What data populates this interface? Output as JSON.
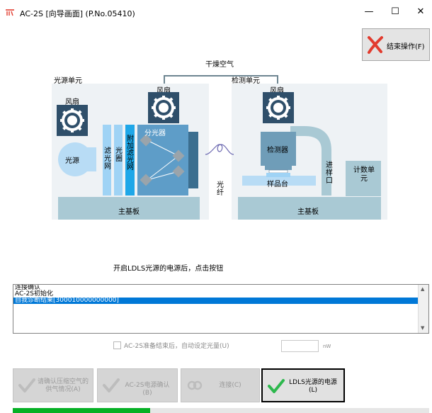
{
  "window": {
    "title": "AC-2S  [向导画面]  (P.No.05410)",
    "minimize": "—",
    "maximize": "☐",
    "close": "✕"
  },
  "exit_button": {
    "label": "结束操作(F)"
  },
  "diagram": {
    "dry_air": "干燥空气",
    "light_unit": "光源单元",
    "detect_unit": "检测单元",
    "fan": "风扇",
    "light_source": "光源",
    "filter": "滤光网",
    "aperture": "光圈",
    "attached_filter": "附加滤光网",
    "spectrometer": "分光器",
    "fiber": "光纤",
    "detector": "检测器",
    "sample_stage": "样品台",
    "inlet": "进样口",
    "counter": "计数单元",
    "mainboard": "主基板"
  },
  "instruction": "开启LDLS光源的电源后，点击按钮",
  "log": {
    "items": [
      {
        "text": "连接确认",
        "selected": false
      },
      {
        "text": "AC-2S初始化",
        "selected": false
      },
      {
        "text": "自我诊断结果[300010000000000]",
        "selected": true
      }
    ]
  },
  "auto_light": {
    "label": "AC-2S准备结束后，自动设定光量(U)",
    "checked": false,
    "value": "",
    "unit": "nW"
  },
  "buttons": [
    {
      "label": "请确认压缩空气的供气情况(A)",
      "enabled": false,
      "icon": "check-icon"
    },
    {
      "label": "AC-2S电源确认(B)",
      "enabled": false,
      "icon": "check-icon"
    },
    {
      "label": "连接(C)",
      "enabled": false,
      "icon": "link-icon"
    },
    {
      "label": "LDLS光源的电源(L)",
      "enabled": true,
      "icon": "check-icon"
    }
  ],
  "progress": {
    "fraction": 0.33
  },
  "colors": {
    "accent": "#0078d7",
    "unit_bg": "#eef2f5",
    "unit_block": "#a9c9d4",
    "component": "#5e9dc8",
    "panel_blue": "#b8dcf5",
    "fan_dark": "#2f4f6a",
    "progress": "#06b025",
    "valid_check": "#2db84d",
    "exit_x": "#e23b2e"
  }
}
